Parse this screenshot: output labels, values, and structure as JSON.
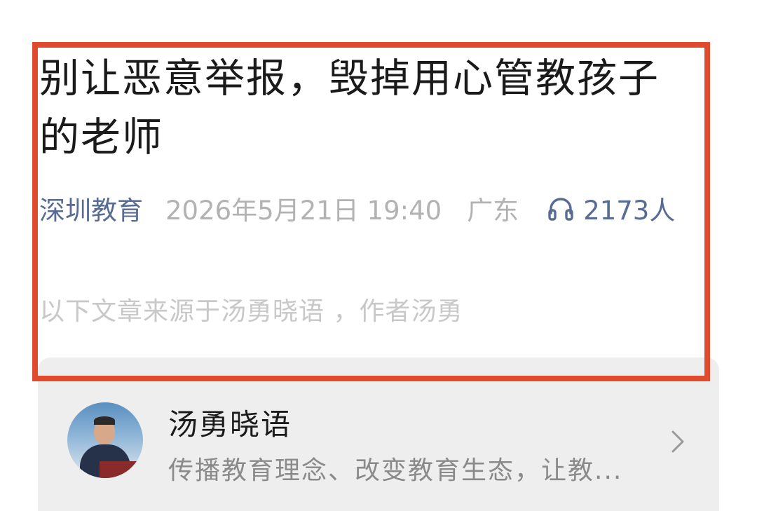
{
  "article": {
    "title": "别让恶意举报，毁掉用心管教孩子的老师",
    "meta": {
      "source": "深圳教育",
      "time": "2026年5月21日 19:40",
      "region": "广东",
      "listen_count": "2173人",
      "listen_icon": "headphones-icon"
    },
    "source_note": "以下文章来源于汤勇晓语 ，作者汤勇"
  },
  "profile_card": {
    "name": "汤勇晓语",
    "description": "传播教育理念、改变教育生态，让教...",
    "arrow_icon": "chevron-right-icon"
  },
  "colors": {
    "highlight_border": "#e14b2d",
    "link_blue": "#576b95",
    "meta_gray": "#b2b2b2",
    "card_bg": "#eeeeee"
  }
}
